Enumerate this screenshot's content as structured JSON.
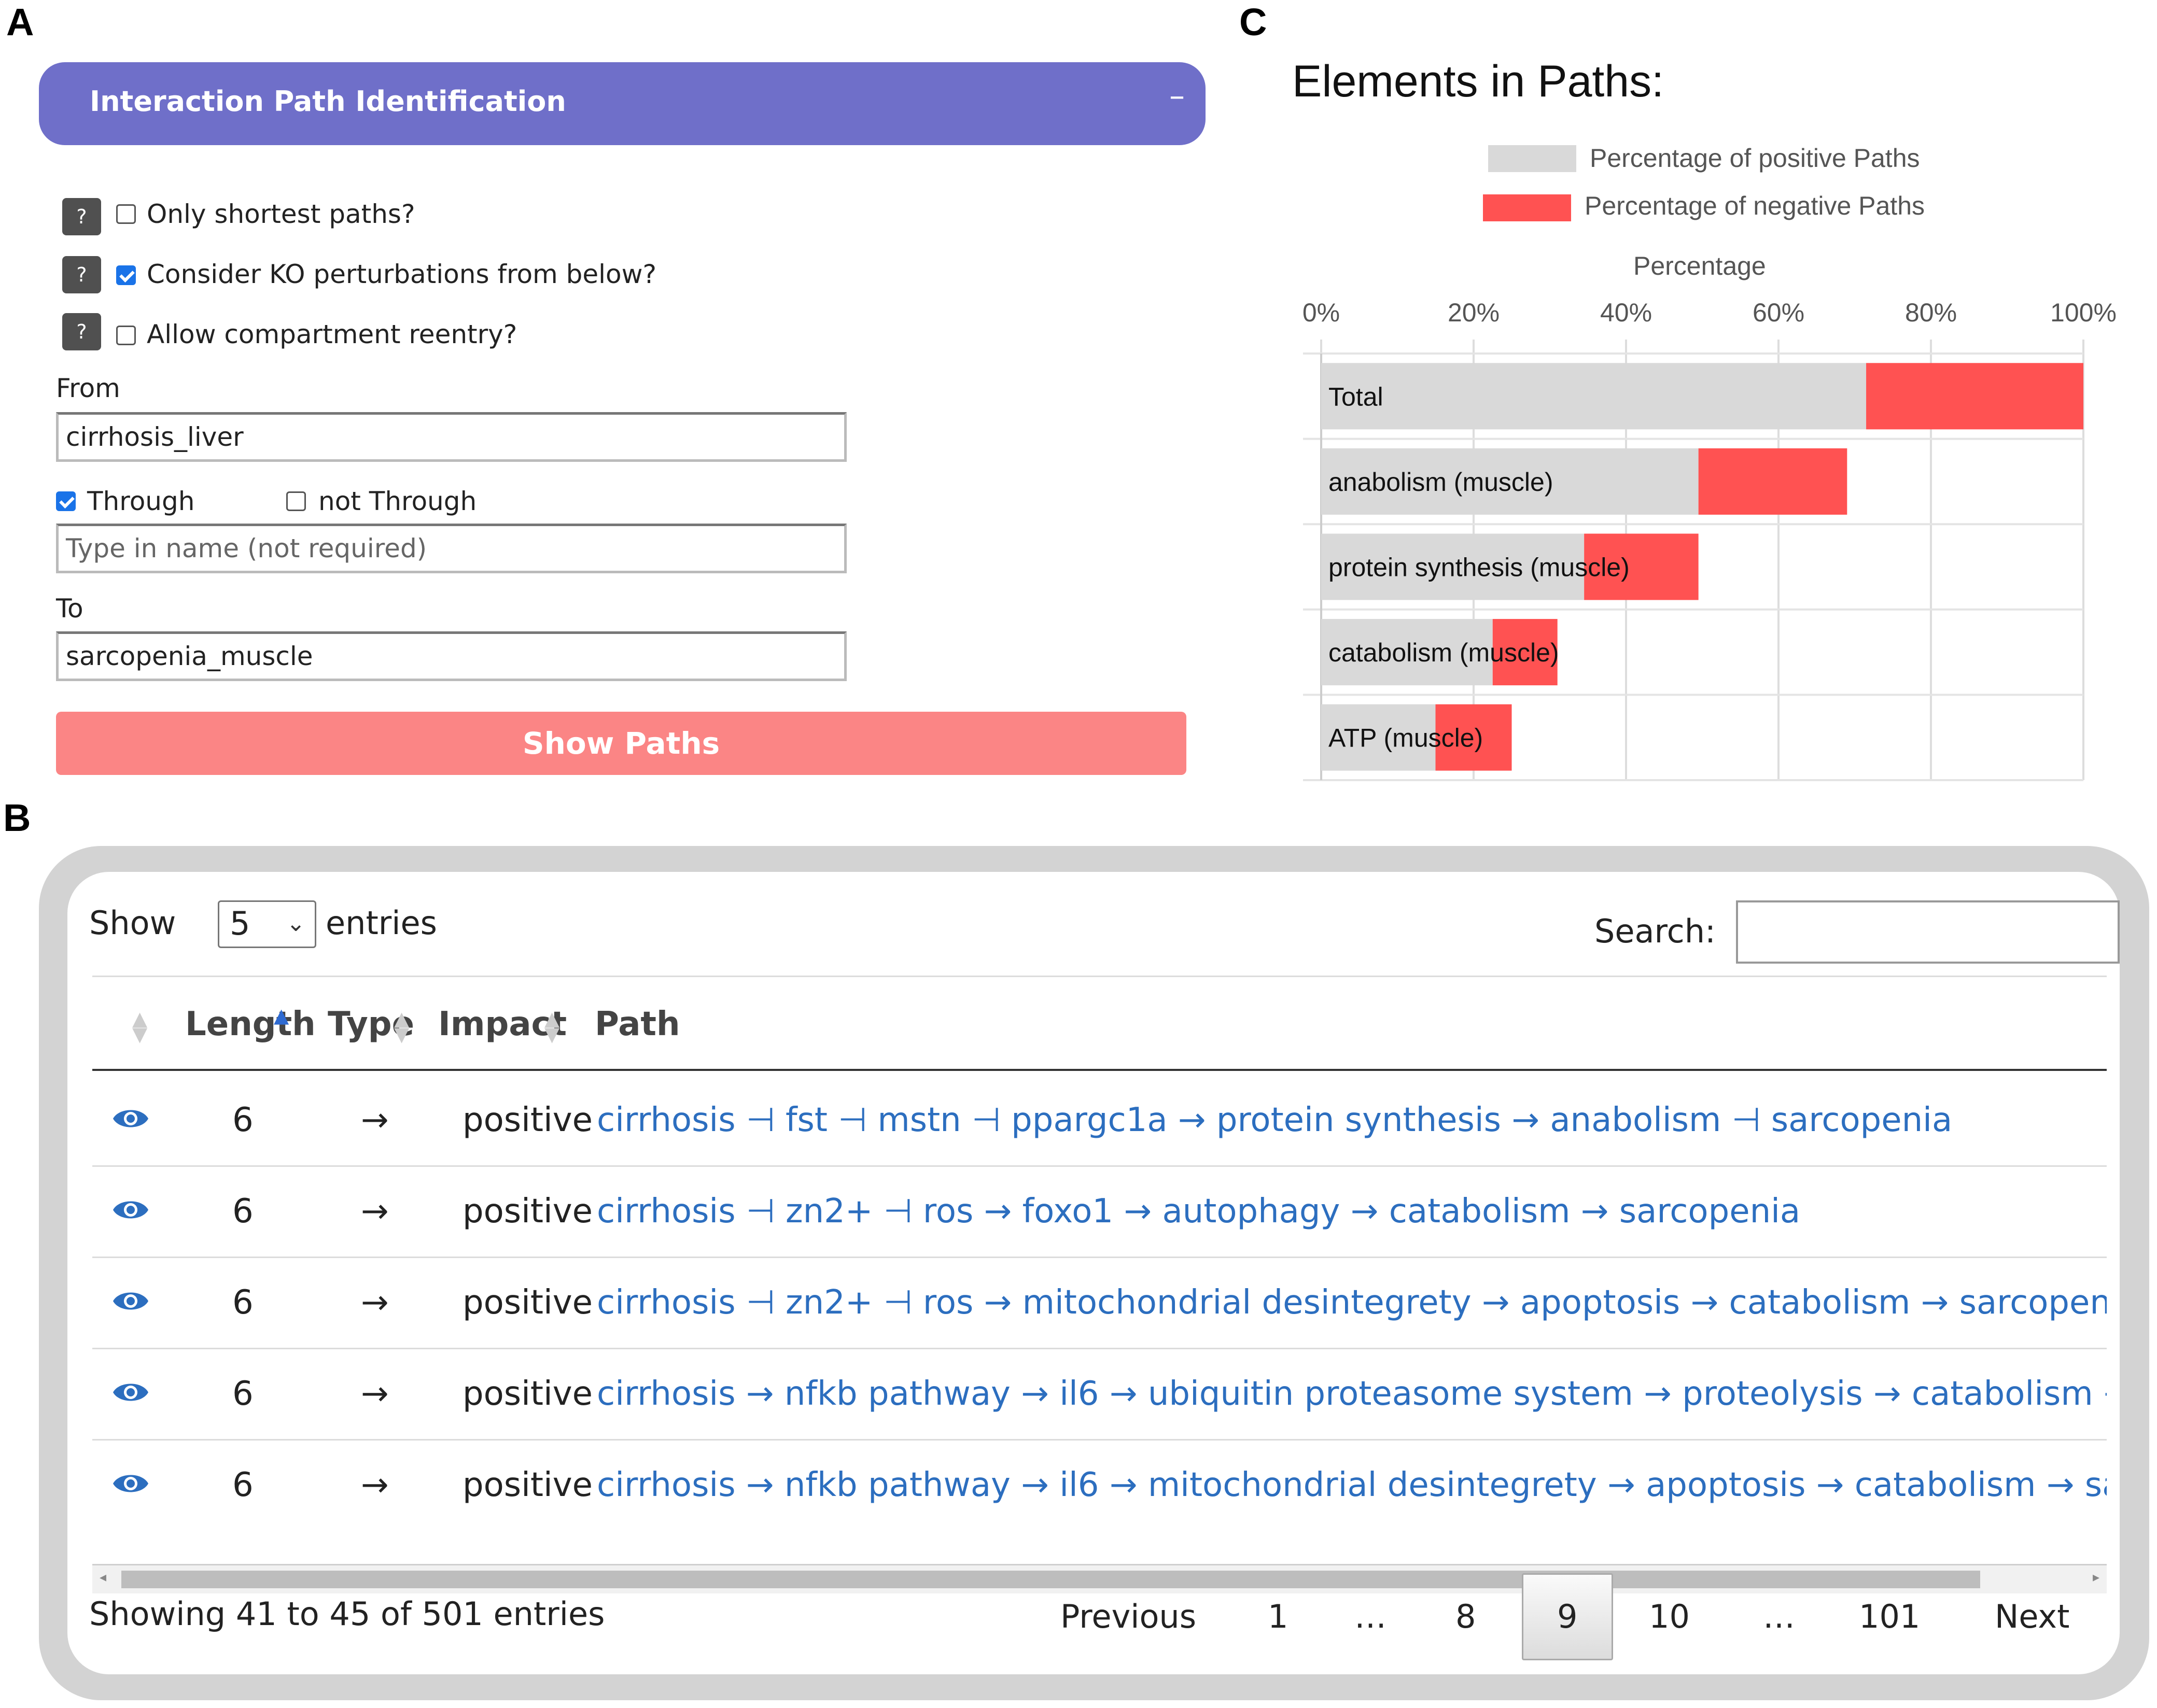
{
  "panel_labels": {
    "a": "A",
    "b": "B",
    "c": "C"
  },
  "form": {
    "header_title": "Interaction Path Identification",
    "collapse_symbol": "–",
    "help_symbol": "?",
    "options": [
      {
        "label": "Only shortest paths?",
        "checked": false
      },
      {
        "label": "Consider KO perturbations from below?",
        "checked": true
      },
      {
        "label": "Allow compartment reentry?",
        "checked": false
      }
    ],
    "from_label": "From",
    "from_value": "cirrhosis_liver",
    "through_label": "Through",
    "through_checked": true,
    "not_through_label": "not Through",
    "not_through_checked": false,
    "through_placeholder": "Type in name (not required)",
    "to_label": "To",
    "to_value": "sarcopenia_muscle",
    "show_paths_label": "Show Paths"
  },
  "chart": {
    "title": "Elements in Paths:",
    "legend_positive": "Percentage of positive Paths",
    "legend_negative": "Percentage of negative Paths",
    "axis_title": "Percentage",
    "colors": {
      "positive": "#d9d9d9",
      "negative": "#ff5252"
    }
  },
  "chart_data": {
    "type": "bar",
    "orientation": "horizontal",
    "stacked": true,
    "title": "Elements in Paths:",
    "xlabel": "Percentage",
    "xlim": [
      0,
      100
    ],
    "x_ticks": [
      "0%",
      "20%",
      "40%",
      "60%",
      "80%",
      "100%"
    ],
    "grid": true,
    "legend_position": "top",
    "categories": [
      "Total",
      "anabolism (muscle)",
      "protein synthesis (muscle)",
      "catabolism (muscle)",
      "ATP (muscle)"
    ],
    "series": [
      {
        "name": "Percentage of positive Paths",
        "values": [
          71.5,
          49.5,
          34.5,
          22.5,
          15.0
        ]
      },
      {
        "name": "Percentage of negative Paths",
        "values": [
          28.5,
          19.5,
          15.0,
          8.5,
          10.0
        ]
      }
    ]
  },
  "table": {
    "show_label": "Show",
    "entries_select": "5",
    "entries_label": "entries",
    "search_label": "Search:",
    "columns": [
      "Length",
      "Type",
      "Impact",
      "Path"
    ],
    "rows": [
      {
        "length": "6",
        "type": "→",
        "impact": "positive",
        "path": "cirrhosis ⊣ fst ⊣ mstn ⊣ ppargc1a → protein synthesis → anabolism ⊣ sarcopenia"
      },
      {
        "length": "6",
        "type": "→",
        "impact": "positive",
        "path": "cirrhosis ⊣ zn2+ ⊣ ros → foxo1 → autophagy → catabolism → sarcopenia"
      },
      {
        "length": "6",
        "type": "→",
        "impact": "positive",
        "path": "cirrhosis ⊣ zn2+ ⊣ ros → mitochondrial desintegrety → apoptosis → catabolism → sarcopenia"
      },
      {
        "length": "6",
        "type": "→",
        "impact": "positive",
        "path": "cirrhosis → nfkb pathway → il6 → ubiquitin proteasome system → proteolysis → catabolism → sarcopenia"
      },
      {
        "length": "6",
        "type": "→",
        "impact": "positive",
        "path": "cirrhosis → nfkb pathway → il6 → mitochondrial desintegrety → apoptosis → catabolism → sarcopenia"
      }
    ],
    "info": "Showing 41 to 45 of 501 entries",
    "pagination": {
      "previous": "Previous",
      "pages": [
        "1",
        "…",
        "8",
        "9",
        "10",
        "…",
        "101"
      ],
      "current": "9",
      "next": "Next"
    }
  }
}
